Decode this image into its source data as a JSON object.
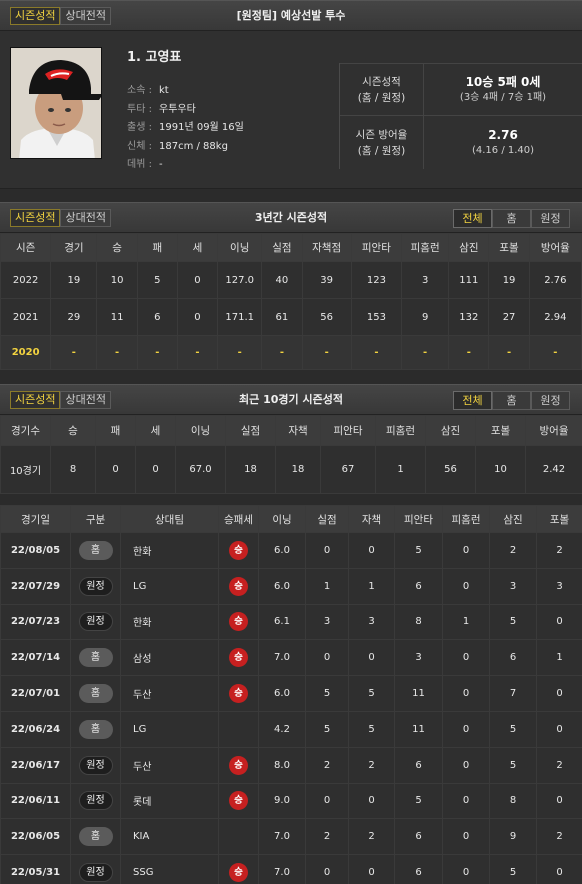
{
  "top": {
    "tab_season": "시즌성적",
    "tab_vs": "상대전적",
    "title": "[원정팀] 예상선발 투수"
  },
  "profile": {
    "name": "1. 고영표",
    "info": [
      {
        "label": "소속 :",
        "value": "kt"
      },
      {
        "label": "투타 :",
        "value": "우투우타"
      },
      {
        "label": "출생 :",
        "value": "1991년 09월 16일"
      },
      {
        "label": "신체 :",
        "value": "187cm / 88kg"
      },
      {
        "label": "데뷔 :",
        "value": "-"
      }
    ],
    "season_record_label1": "시즌성적",
    "season_record_label2": "(홈 / 원정)",
    "season_record_value": "10승 5패 0세",
    "season_record_sub": "(3승 4패 / 7승 1패)",
    "era_label1": "시즌 방어율",
    "era_label2": "(홈 / 원정)",
    "era_value": "2.76",
    "era_sub": "(4.16 / 1.40)"
  },
  "three_year": {
    "tab_season": "시즌성적",
    "tab_vs": "상대전적",
    "title": "3년간 시즌성적",
    "filters": [
      "전체",
      "홈",
      "원정"
    ],
    "headers": [
      "시즌",
      "경기",
      "승",
      "패",
      "세",
      "이닝",
      "실점",
      "자책점",
      "피안타",
      "피홈런",
      "삼진",
      "포볼",
      "방어율"
    ],
    "rows": [
      [
        "2022",
        "19",
        "10",
        "5",
        "0",
        "127.0",
        "40",
        "39",
        "123",
        "3",
        "111",
        "19",
        "2.76"
      ],
      [
        "2021",
        "29",
        "11",
        "6",
        "0",
        "171.1",
        "61",
        "56",
        "153",
        "9",
        "132",
        "27",
        "2.94"
      ],
      [
        "2020",
        "-",
        "-",
        "-",
        "-",
        "-",
        "-",
        "-",
        "-",
        "-",
        "-",
        "-",
        "-"
      ]
    ]
  },
  "recent": {
    "tab_season": "시즌성적",
    "tab_vs": "상대전적",
    "title": "최근 10경기 시즌성적",
    "filters": [
      "전체",
      "홈",
      "원정"
    ],
    "summary_headers": [
      "경기수",
      "승",
      "패",
      "세",
      "이닝",
      "실점",
      "자책",
      "피안타",
      "피홈런",
      "삼진",
      "포볼",
      "방어율"
    ],
    "summary_row": [
      "10경기",
      "8",
      "0",
      "0",
      "67.0",
      "18",
      "18",
      "67",
      "1",
      "56",
      "10",
      "2.42"
    ],
    "game_headers": [
      "경기일",
      "구분",
      "상대팀",
      "승패세",
      "이닝",
      "실점",
      "자책",
      "피안타",
      "피홈런",
      "삼진",
      "포볼"
    ],
    "games": [
      {
        "date": "22/08/05",
        "ha": "홈",
        "opp": "한화",
        "res": "승",
        "ip": "6.0",
        "r": "0",
        "er": "0",
        "h": "5",
        "hr": "0",
        "so": "2",
        "bb": "2"
      },
      {
        "date": "22/07/29",
        "ha": "원정",
        "opp": "LG",
        "res": "승",
        "ip": "6.0",
        "r": "1",
        "er": "1",
        "h": "6",
        "hr": "0",
        "so": "3",
        "bb": "3"
      },
      {
        "date": "22/07/23",
        "ha": "원정",
        "opp": "한화",
        "res": "승",
        "ip": "6.1",
        "r": "3",
        "er": "3",
        "h": "8",
        "hr": "1",
        "so": "5",
        "bb": "0"
      },
      {
        "date": "22/07/14",
        "ha": "홈",
        "opp": "삼성",
        "res": "승",
        "ip": "7.0",
        "r": "0",
        "er": "0",
        "h": "3",
        "hr": "0",
        "so": "6",
        "bb": "1"
      },
      {
        "date": "22/07/01",
        "ha": "홈",
        "opp": "두산",
        "res": "승",
        "ip": "6.0",
        "r": "5",
        "er": "5",
        "h": "11",
        "hr": "0",
        "so": "7",
        "bb": "0"
      },
      {
        "date": "22/06/24",
        "ha": "홈",
        "opp": "LG",
        "res": "",
        "ip": "4.2",
        "r": "5",
        "er": "5",
        "h": "11",
        "hr": "0",
        "so": "5",
        "bb": "0"
      },
      {
        "date": "22/06/17",
        "ha": "원정",
        "opp": "두산",
        "res": "승",
        "ip": "8.0",
        "r": "2",
        "er": "2",
        "h": "6",
        "hr": "0",
        "so": "5",
        "bb": "2"
      },
      {
        "date": "22/06/11",
        "ha": "원정",
        "opp": "롯데",
        "res": "승",
        "ip": "9.0",
        "r": "0",
        "er": "0",
        "h": "5",
        "hr": "0",
        "so": "8",
        "bb": "0"
      },
      {
        "date": "22/06/05",
        "ha": "홈",
        "opp": "KIA",
        "res": "",
        "ip": "7.0",
        "r": "2",
        "er": "2",
        "h": "6",
        "hr": "0",
        "so": "9",
        "bb": "2"
      },
      {
        "date": "22/05/31",
        "ha": "원정",
        "opp": "SSG",
        "res": "승",
        "ip": "7.0",
        "r": "0",
        "er": "0",
        "h": "6",
        "hr": "0",
        "so": "5",
        "bb": "0"
      }
    ]
  }
}
